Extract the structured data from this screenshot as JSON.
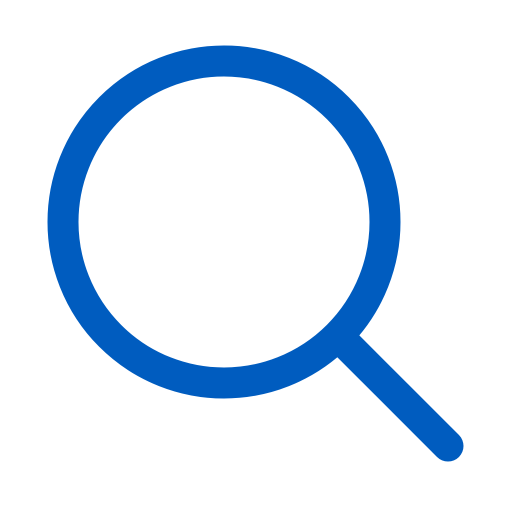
{
  "icon": {
    "name": "search-icon",
    "color": "#005CBF",
    "background": "#FFFFFF"
  }
}
